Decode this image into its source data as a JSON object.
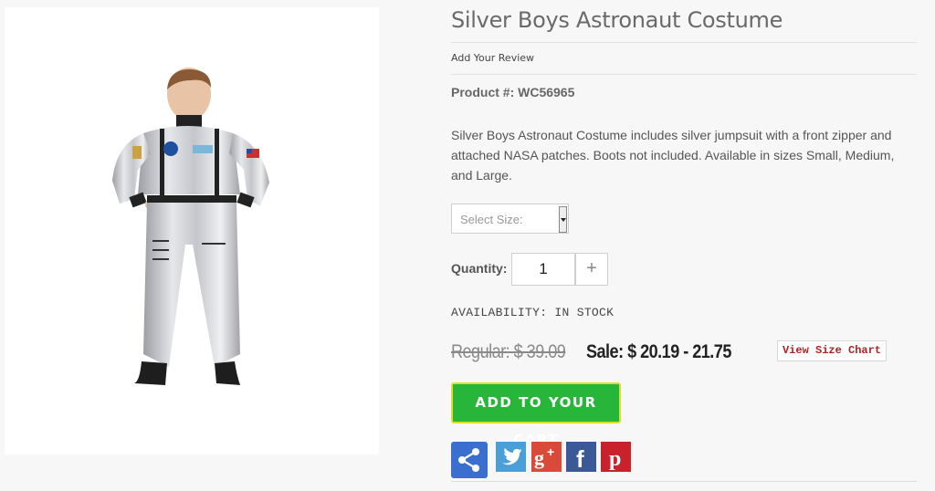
{
  "product": {
    "title": "Silver Boys Astronaut Costume",
    "review_link": "Add Your Review",
    "product_number": "Product #: WC56965",
    "description": "Silver Boys Astronaut Costume includes silver jumpsuit with a front zipper and attached NASA patches. Boots not included. Available in sizes Small, Medium, and Large.",
    "image_alt": "Boy wearing silver astronaut jumpsuit"
  },
  "options": {
    "size_placeholder": "Select Size:",
    "quantity_label": "Quantity:",
    "quantity_value": "1",
    "plus_label": "+"
  },
  "availability": "AVAILABILITY: IN STOCK",
  "pricing": {
    "regular": "Regular: $ 39.09",
    "sale": "Sale: $ 20.19 - 21.75",
    "size_chart": "View Size Chart"
  },
  "cart": {
    "button_label": "ADD TO YOUR CART"
  },
  "social": {
    "icons": [
      "share-icon",
      "twitter-icon",
      "google-plus-icon",
      "facebook-icon",
      "pinterest-icon"
    ]
  },
  "colors": {
    "cart_green": "#27b63a",
    "cart_border": "#d9e02a",
    "size_chart_red": "#b22222",
    "share_blue": "#3b6fcf",
    "twitter_blue": "#4a9fd8",
    "google_red": "#d94a38",
    "facebook_blue": "#3b5998",
    "pinterest_red": "#c8232c"
  }
}
